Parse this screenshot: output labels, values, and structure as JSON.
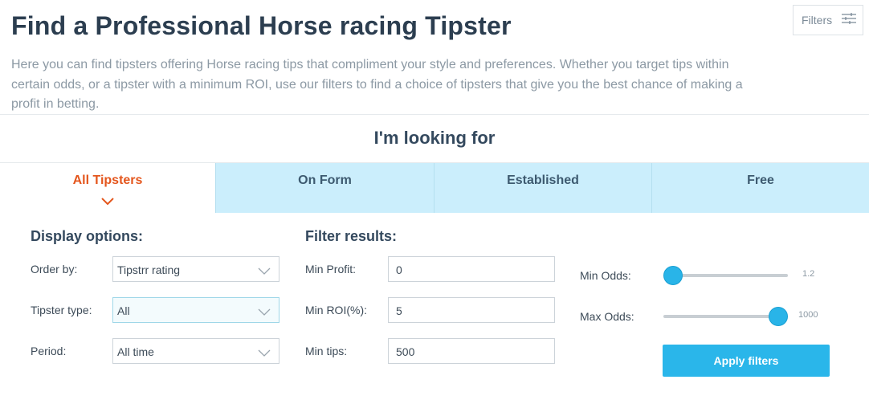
{
  "header": {
    "title": "Find a Professional Horse racing Tipster",
    "filters_button": "Filters",
    "intro": "Here you can find tipsters offering Horse racing tips that compliment your style and preferences. Whether you target tips within certain odds, or a tipster with a minimum ROI, use our filters to find a choice of tipsters that give you the best chance of making a profit in betting."
  },
  "looking_for": "I'm looking for",
  "tabs": [
    {
      "label": "All Tipsters",
      "active": true
    },
    {
      "label": "On Form",
      "active": false
    },
    {
      "label": "Established",
      "active": false
    },
    {
      "label": "Free",
      "active": false
    }
  ],
  "display_options": {
    "heading": "Display options:",
    "order_by": {
      "label": "Order by:",
      "value": "Tipstrr rating"
    },
    "tipster_type": {
      "label": "Tipster type:",
      "value": "All"
    },
    "period": {
      "label": "Period:",
      "value": "All time"
    }
  },
  "filter_results": {
    "heading": "Filter results:",
    "min_profit": {
      "label": "Min Profit:",
      "value": "0"
    },
    "min_roi": {
      "label": "Min ROI(%):",
      "value": "5"
    },
    "min_tips": {
      "label": "Min tips:",
      "value": "500"
    }
  },
  "odds": {
    "min": {
      "label": "Min Odds:",
      "value": "1.2"
    },
    "max": {
      "label": "Max Odds:",
      "value": "1000"
    }
  },
  "apply_button": "Apply filters",
  "colors": {
    "accent": "#2ab6ea",
    "active_tab": "#e4561d",
    "tab_bg": "#cbeefc"
  }
}
